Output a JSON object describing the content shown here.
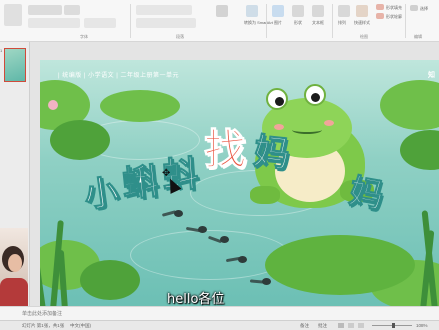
{
  "ribbon": {
    "groups": [
      "字体",
      "段落",
      "绘图",
      "编辑"
    ],
    "buttons": [
      "转换为 SmartArt",
      "图片",
      "形状",
      "文本框",
      "排列",
      "快速样式",
      "形状填充",
      "形状轮廓",
      "选择"
    ],
    "accent": "#c43e2c"
  },
  "slide_panel": {
    "slide_number": "1"
  },
  "slide": {
    "header": "| 统编版 | 小学语文 | 二年级上册第一单元",
    "title_chars": [
      "小",
      "蝌",
      "蚪",
      "找",
      "妈",
      "妈"
    ],
    "watermark": "知"
  },
  "subtitle": "hello各位",
  "notes": {
    "placeholder": "单击此处添加备注"
  },
  "status": {
    "slide_info": "幻灯片 第1张，共1张",
    "language": "中文(中国)",
    "notes_btn": "备注",
    "comments_btn": "批注",
    "zoom": "108%"
  },
  "icons": [
    "move-cursor-icon",
    "arrow-cursor-icon",
    "notes-icon",
    "view-normal-icon",
    "view-sorter-icon",
    "view-reading-icon",
    "view-slideshow-icon"
  ]
}
